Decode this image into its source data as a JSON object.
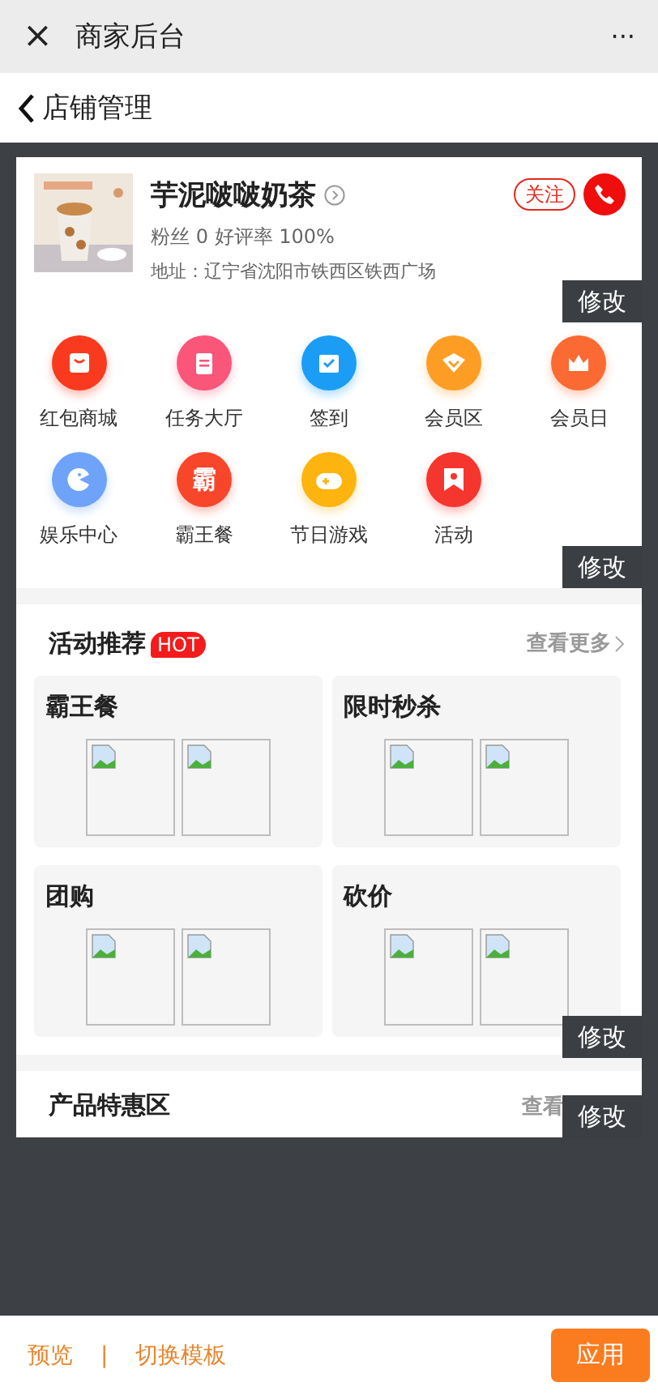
{
  "window": {
    "title": "商家后台",
    "close": "×",
    "more": "···"
  },
  "nav": {
    "title": "店铺管理"
  },
  "store": {
    "name": "芋泥啵啵奶茶",
    "stats": "粉丝 0 好评率 100%",
    "address": "地址：辽宁省沈阳市铁西区铁西广场",
    "follow": "关注",
    "edit": "修改"
  },
  "shortcuts": [
    {
      "label": "红包商城",
      "kind": "bag",
      "color": "#fa3a1e"
    },
    {
      "label": "任务大厅",
      "kind": "clipboard",
      "color": "#f9567a"
    },
    {
      "label": "签到",
      "kind": "calendar",
      "color": "#1b9df6"
    },
    {
      "label": "会员区",
      "kind": "diamond",
      "color": "#fd9d24"
    },
    {
      "label": "会员日",
      "kind": "crown",
      "color": "#fb6a32"
    },
    {
      "label": "娱乐中心",
      "kind": "pacman",
      "color": "#6ea3f9"
    },
    {
      "label": "霸王餐",
      "kind": "glyph",
      "glyph": "霸",
      "color": "#f8462a"
    },
    {
      "label": "节日游戏",
      "kind": "gamepad",
      "color": "#fdb40f"
    },
    {
      "label": "活动",
      "kind": "bookmark",
      "color": "#f5362e"
    }
  ],
  "shortcuts_edit": "修改",
  "activities": {
    "title": "活动推荐",
    "badge": "HOT",
    "more": "查看更多",
    "edit": "修改",
    "cards": [
      {
        "title": "霸王餐"
      },
      {
        "title": "限时秒杀"
      },
      {
        "title": "团购"
      },
      {
        "title": "砍价"
      }
    ]
  },
  "products": {
    "title": "产品特惠区",
    "more": "查看",
    "edit": "修改"
  },
  "footer": {
    "preview": "预览",
    "separator": "|",
    "switch": "切换模板",
    "apply": "应用"
  }
}
